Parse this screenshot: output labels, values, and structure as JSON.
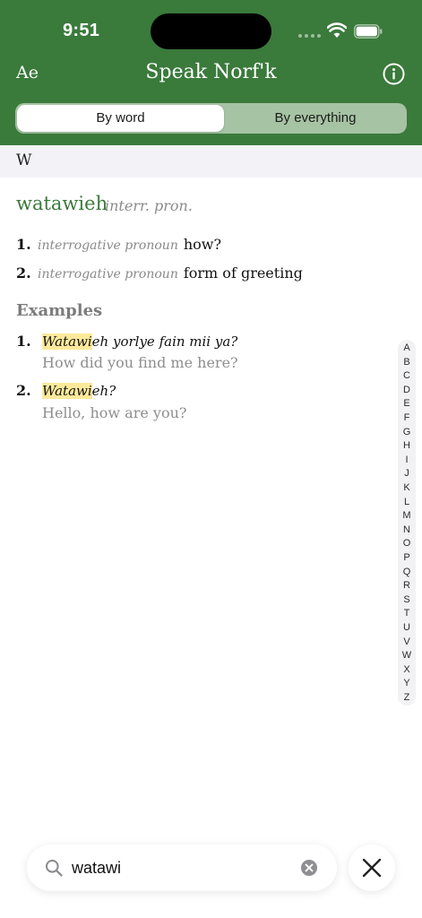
{
  "status_bar": {
    "time": "9:51",
    "wifi_icon": "wifi-icon",
    "battery_icon": "battery-icon"
  },
  "header": {
    "left_label": "Ae",
    "title": "Speak Norf'k",
    "info_icon": "info-icon",
    "background_color": "#3a7a3b"
  },
  "segmented_control": {
    "options": [
      "By word",
      "By everything"
    ],
    "selected": "By word"
  },
  "section": {
    "letter": "W"
  },
  "entry": {
    "headword": "watawieh",
    "part_of_speech": "interr. pron.",
    "senses": [
      {
        "number": "1.",
        "pos": "interrogative pronoun",
        "definition": "how?"
      },
      {
        "number": "2.",
        "pos": "interrogative pronoun",
        "definition": "form of greeting"
      }
    ]
  },
  "examples": {
    "heading": "Examples",
    "items": [
      {
        "number": "1.",
        "match": "Watawi",
        "rest": "eh yorlye fain mii ya?",
        "translation": "How did you find me here?"
      },
      {
        "number": "2.",
        "match": "Watawi",
        "rest": "eh?",
        "translation": "Hello, how are you?"
      }
    ]
  },
  "index": {
    "letters": [
      "A",
      "B",
      "C",
      "D",
      "E",
      "F",
      "G",
      "H",
      "I",
      "J",
      "K",
      "L",
      "M",
      "N",
      "O",
      "P",
      "Q",
      "R",
      "S",
      "T",
      "U",
      "V",
      "W",
      "X",
      "Y",
      "Z"
    ]
  },
  "search": {
    "value": "watawi",
    "search_icon": "magnifier-icon",
    "clear_icon": "clear-icon",
    "close_icon": "close-icon"
  },
  "colors": {
    "accent": "#3a7a3b",
    "highlight": "#fde99a"
  }
}
